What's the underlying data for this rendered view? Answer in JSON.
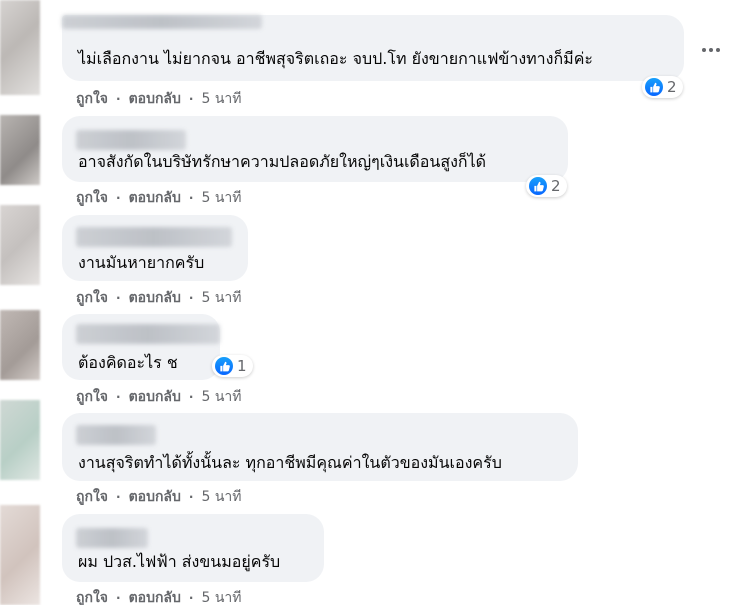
{
  "comments": [
    {
      "text": "ไม่เลือกงาน ไม่ยากจน อาชีพสุจริตเถอะ จบป.โท ยังขายกาแฟข้างทางก็มีค่ะ",
      "reaction_count": "2",
      "like_label": "ถูกใจ",
      "reply_label": "ตอบกลับ",
      "separator": "·",
      "time": "5 นาที"
    },
    {
      "text": "อาจสังกัดในบริษัทรักษาความปลอดภัยใหญ่ๆเงินเดือนสูงก็ได้",
      "reaction_count": "2",
      "like_label": "ถูกใจ",
      "reply_label": "ตอบกลับ",
      "separator": "·",
      "time": "5 นาที"
    },
    {
      "text": "งานมันหายากครับ",
      "like_label": "ถูกใจ",
      "reply_label": "ตอบกลับ",
      "separator": "·",
      "time": "5 นาที"
    },
    {
      "text": "ต้องคิดอะไร ช",
      "reaction_count": "1",
      "like_label": "ถูกใจ",
      "reply_label": "ตอบกลับ",
      "separator": "·",
      "time": "5 นาที"
    },
    {
      "text": "งานสุจริตทำได้ทั้งนั้นละ ทุกอาชีพมีคุณค่าในตัวของมันเองครับ",
      "like_label": "ถูกใจ",
      "reply_label": "ตอบกลับ",
      "separator": "·",
      "time": "5 นาที"
    },
    {
      "text": "ผม ปวส.ไฟฟ้า ส่งขนมอยู่ครับ",
      "like_label": "ถูกใจ",
      "reply_label": "ตอบกลับ",
      "separator": "·",
      "time": "5 นาที"
    }
  ],
  "icons": {
    "reaction": "like-icon",
    "more": "more-options-icon"
  },
  "colors": {
    "bubble": "#f0f2f5",
    "secondary_text": "#65676b",
    "like_blue": "#0866ff"
  }
}
